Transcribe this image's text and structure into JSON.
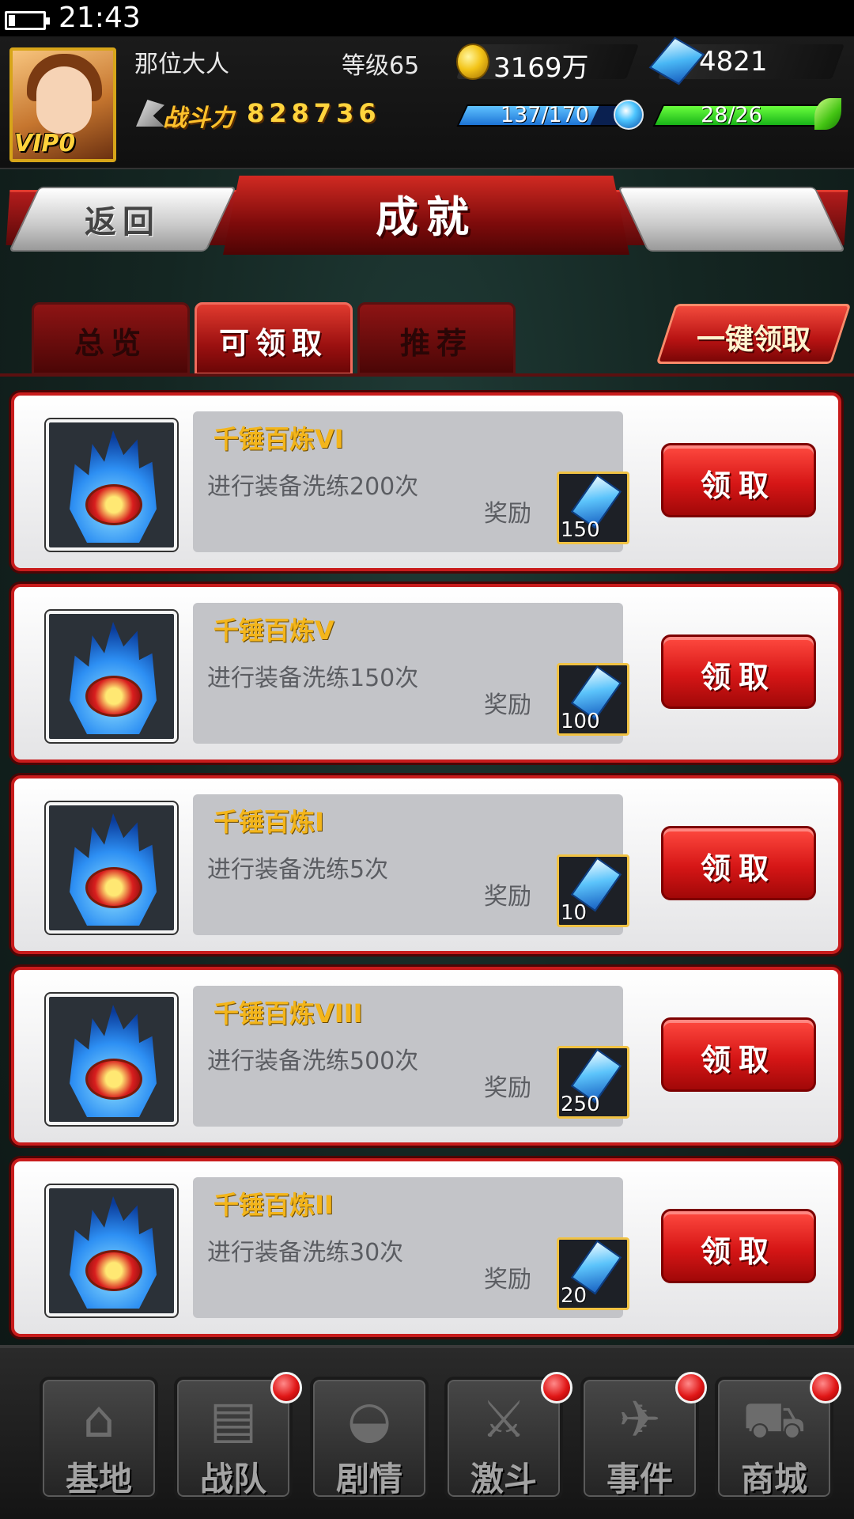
{
  "status_bar": {
    "time": "21:43"
  },
  "player": {
    "name": "那位大人",
    "level": "等级65",
    "vip": "VIP0",
    "gold": "3169万",
    "gems": "4821",
    "power_label": "战斗力",
    "power_value": "828736",
    "stamina": "137/170",
    "stamina_fraction": 0.806,
    "energy": "28/26",
    "energy_fraction": 1.0
  },
  "titlebar": {
    "back_label": "返回",
    "title": "成就"
  },
  "tabs": [
    {
      "label": "总览",
      "active": false
    },
    {
      "label": "可领取",
      "active": true
    },
    {
      "label": "推荐",
      "active": false
    }
  ],
  "claim_all_label": "一键领取",
  "reward_label": "奖励",
  "claim_label": "领取",
  "achievements": [
    {
      "name": "千锤百炼VI",
      "desc": "进行装备洗练200次",
      "reward": "150",
      "icon": "blue-flame-icon"
    },
    {
      "name": "千锤百炼V",
      "desc": "进行装备洗练150次",
      "reward": "100",
      "icon": "blue-flame-icon"
    },
    {
      "name": "千锤百炼I",
      "desc": "进行装备洗练5次",
      "reward": "10",
      "icon": "blue-flame-icon"
    },
    {
      "name": "千锤百炼VIII",
      "desc": "进行装备洗练500次",
      "reward": "250",
      "icon": "blue-flame-icon"
    },
    {
      "name": "千锤百炼II",
      "desc": "进行装备洗练30次",
      "reward": "20",
      "icon": "blue-flame-icon"
    }
  ],
  "nav": [
    {
      "label": "基地",
      "glyph": "⌂",
      "icon": "base-icon",
      "badge": false
    },
    {
      "label": "战队",
      "glyph": "▤",
      "icon": "cards-icon",
      "badge": true
    },
    {
      "label": "剧情",
      "glyph": "◒",
      "icon": "hero-mask-icon",
      "badge": false
    },
    {
      "label": "激斗",
      "glyph": "⚔",
      "icon": "fighter-icon",
      "badge": true
    },
    {
      "label": "事件",
      "glyph": "✈",
      "icon": "event-icon",
      "badge": true
    },
    {
      "label": "商城",
      "glyph": "⛟",
      "icon": "shopping-cart-icon",
      "badge": true
    }
  ],
  "colors": {
    "accent_red": "#c81c1c",
    "gold_text": "#f3b51b",
    "stamina_blue": "#1d74d6",
    "energy_green": "#18b418"
  }
}
